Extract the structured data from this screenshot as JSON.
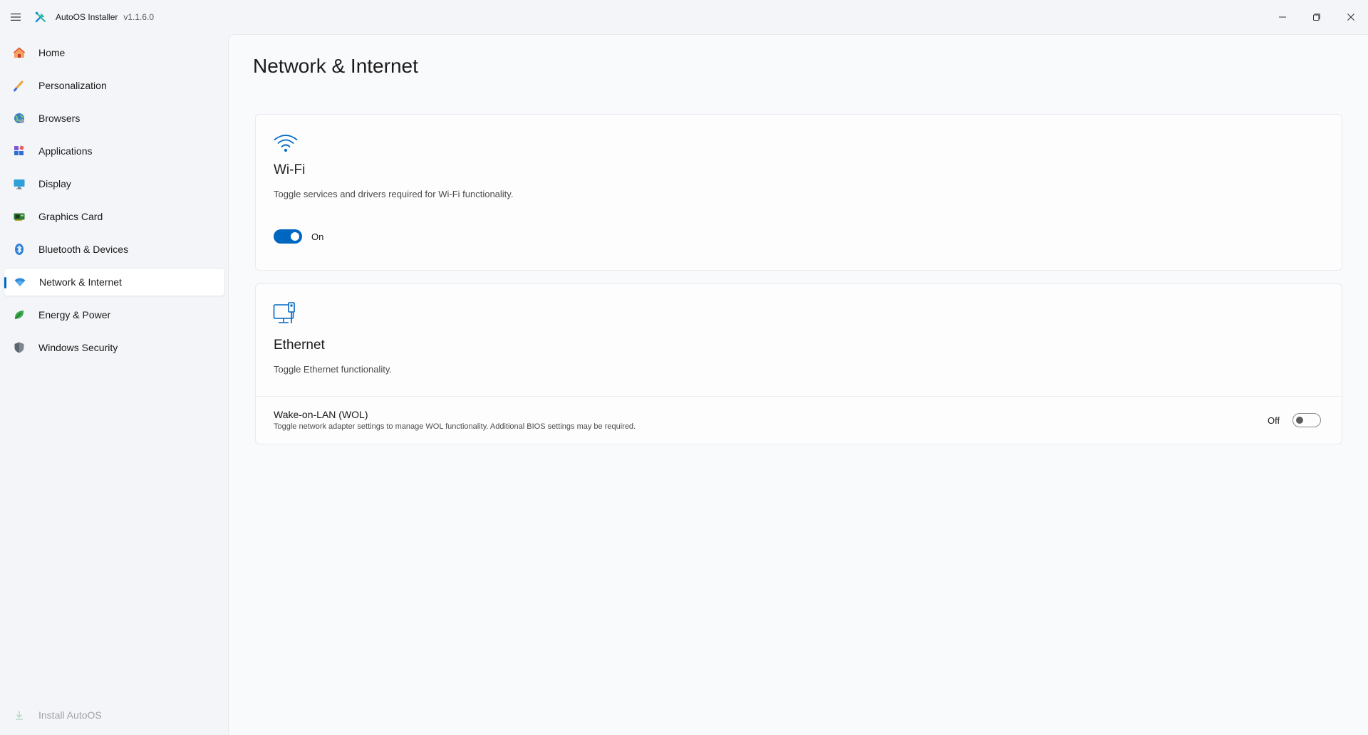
{
  "titlebar": {
    "menu_icon": "hamburger-menu-icon",
    "app_icon": "tools-icon",
    "title": "AutoOS Installer",
    "version": "v1.1.6.0",
    "controls": [
      "minimize-icon",
      "restore-icon",
      "close-icon"
    ]
  },
  "sidebar": {
    "items": [
      {
        "label": "Home",
        "icon": "home-icon"
      },
      {
        "label": "Personalization",
        "icon": "brush-icon"
      },
      {
        "label": "Browsers",
        "icon": "globe-icon"
      },
      {
        "label": "Applications",
        "icon": "apps-icon"
      },
      {
        "label": "Display",
        "icon": "monitor-icon"
      },
      {
        "label": "Graphics Card",
        "icon": "gpu-icon"
      },
      {
        "label": "Bluetooth & Devices",
        "icon": "bluetooth-icon"
      },
      {
        "label": "Network & Internet",
        "icon": "wifi-icon",
        "selected": true
      },
      {
        "label": "Energy & Power",
        "icon": "leaf-icon"
      },
      {
        "label": "Windows Security",
        "icon": "shield-icon"
      }
    ],
    "footer": {
      "label": "Install AutoOS",
      "icon": "download-icon",
      "enabled": false
    }
  },
  "main": {
    "page_title": "Network & Internet",
    "wifi": {
      "icon": "wifi-icon",
      "title": "Wi-Fi",
      "description": "Toggle services and drivers required for Wi-Fi functionality.",
      "toggle_state": "On"
    },
    "ethernet": {
      "icon": "ethernet-icon",
      "title": "Ethernet",
      "description": "Toggle Ethernet functionality.",
      "wol": {
        "title": "Wake-on-LAN (WOL)",
        "description": "Toggle network adapter settings to manage WOL functionality. Additional BIOS settings may be required.",
        "toggle_state": "Off"
      }
    }
  },
  "colors": {
    "accent": "#0067c0",
    "sidebar_bg": "#f3f5f8",
    "content_bg": "#f9fafc",
    "card_bg": "#fdfdfe"
  }
}
